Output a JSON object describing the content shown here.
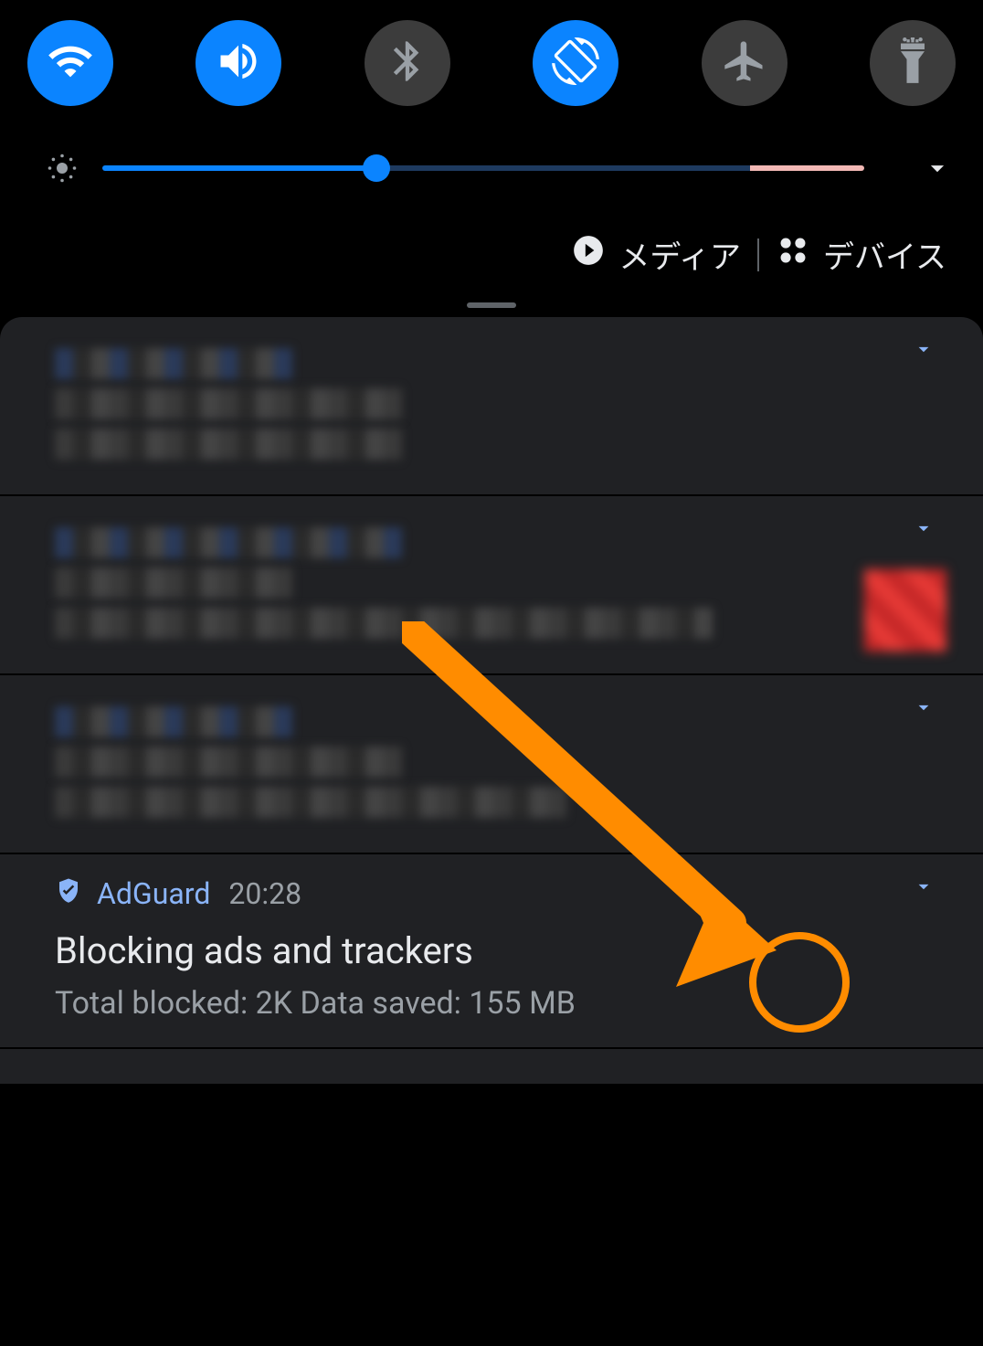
{
  "quick_settings": {
    "toggles": [
      {
        "name": "wifi",
        "on": true
      },
      {
        "name": "sound",
        "on": true
      },
      {
        "name": "bluetooth",
        "on": false
      },
      {
        "name": "auto-rotate",
        "on": true
      },
      {
        "name": "airplane",
        "on": false
      },
      {
        "name": "flashlight",
        "on": false
      }
    ],
    "brightness_percent": 36
  },
  "media_row": {
    "media_label": "メディア",
    "devices_label": "デバイス"
  },
  "notifications": {
    "adguard": {
      "app_name": "AdGuard",
      "time": "20:28",
      "title": "Blocking ads and trackers",
      "subtitle": "Total blocked: 2K Data saved: 155 MB"
    }
  }
}
